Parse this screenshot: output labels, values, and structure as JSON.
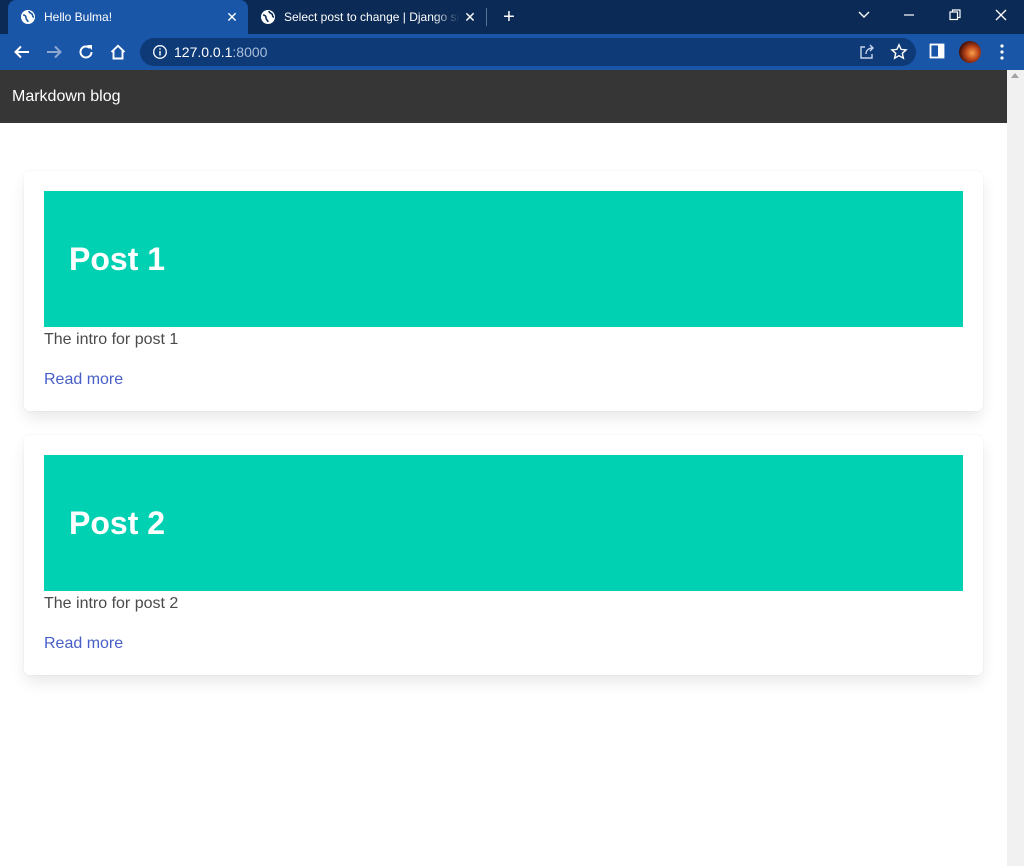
{
  "browser": {
    "tabs": [
      {
        "title": "Hello Bulma!",
        "active": true
      },
      {
        "title": "Select post to change | Django site admin",
        "active": false
      }
    ],
    "url": {
      "host": "127.0.0.1",
      "port": ":8000"
    }
  },
  "site": {
    "brand": "Markdown blog"
  },
  "posts": [
    {
      "title": "Post 1",
      "intro": "The intro for post 1",
      "link": "Read more"
    },
    {
      "title": "Post 2",
      "intro": "The intro for post 2",
      "link": "Read more"
    }
  ],
  "colors": {
    "hero": "#00d1b2",
    "navbar": "#363636",
    "link": "#485fc7",
    "tab_bar": "#0b2a55",
    "toolbar": "#1a56a8"
  }
}
